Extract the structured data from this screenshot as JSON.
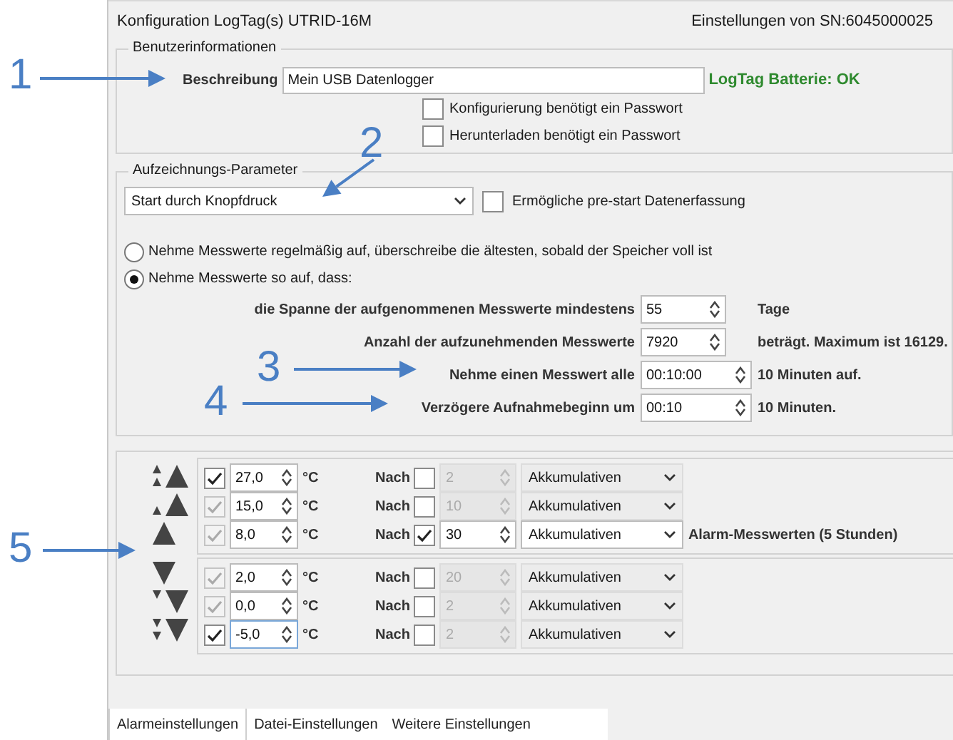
{
  "window": {
    "title": "Konfiguration LogTag(s) UTRID-16M",
    "serial": "Einstellungen von SN:6045000025"
  },
  "user_info": {
    "legend": "Benutzerinformationen",
    "description_label": "Beschreibung",
    "description_value": "Mein USB Datenlogger",
    "battery_status": "LogTag Batterie: OK",
    "options": [
      {
        "label": "Konfigurierung benötigt ein Passwort",
        "checked": false
      },
      {
        "label": "Herunterladen benötigt ein Passwort",
        "checked": false
      }
    ]
  },
  "recording": {
    "legend": "Aufzeichnungs-Parameter",
    "start_mode": "Start durch Knopfdruck",
    "prestart": {
      "label": "Ermögliche pre-start Datenerfassung",
      "checked": false
    },
    "modes": [
      {
        "label": "Nehme Messwerte regelmäßig auf, überschreibe die ältesten, sobald der Speicher voll ist",
        "selected": false
      },
      {
        "label": "Nehme Messwerte so auf, dass:",
        "selected": true
      }
    ],
    "params": [
      {
        "label": "die Spanne der aufgenommenen Messwerte mindestens",
        "value": "55",
        "unit": "Tage"
      },
      {
        "label": "Anzahl der aufzunehmenden Messwerte",
        "value": "7920",
        "unit": "beträgt. Maximum ist 16129."
      },
      {
        "label": "Nehme einen Messwert alle",
        "value": "00:10:00",
        "unit": "10 Minuten auf."
      },
      {
        "label": "Verzögere Aufnahmebeginn um",
        "value": "00:10",
        "unit": "10 Minuten."
      }
    ]
  },
  "alarms": {
    "groups": [
      {
        "rows": [
          {
            "checked": true,
            "disabled": false,
            "value": "27,0",
            "unit": "°C",
            "after_label": "Nach",
            "after_checked": false,
            "count": "2",
            "mode": "Akkumulativen"
          },
          {
            "checked": true,
            "disabled": true,
            "value": "15,0",
            "unit": "°C",
            "after_label": "Nach",
            "after_checked": false,
            "count": "10",
            "mode": "Akkumulativen"
          },
          {
            "checked": true,
            "disabled": true,
            "value": "8,0",
            "unit": "°C",
            "after_label": "Nach",
            "after_checked": true,
            "count": "30",
            "mode": "Akkumulativen",
            "note": "Alarm-Messwerten (5 Stunden)"
          }
        ]
      },
      {
        "rows": [
          {
            "checked": true,
            "disabled": true,
            "value": "2,0",
            "unit": "°C",
            "after_label": "Nach",
            "after_checked": false,
            "count": "20",
            "mode": "Akkumulativen"
          },
          {
            "checked": true,
            "disabled": true,
            "value": "0,0",
            "unit": "°C",
            "after_label": "Nach",
            "after_checked": false,
            "count": "2",
            "mode": "Akkumulativen"
          },
          {
            "checked": true,
            "disabled": false,
            "value": "-5,0",
            "unit": "°C",
            "after_label": "Nach",
            "after_checked": false,
            "count": "2",
            "mode": "Akkumulativen"
          }
        ]
      }
    ]
  },
  "tabs": [
    {
      "label": "Alarmeinstellungen",
      "selected": true
    },
    {
      "label": "Datei-Einstellungen",
      "selected": false
    },
    {
      "label": "Weitere Einstellungen",
      "selected": false
    }
  ],
  "callouts": [
    {
      "number": "1"
    },
    {
      "number": "2"
    },
    {
      "number": "3"
    },
    {
      "number": "4"
    },
    {
      "number": "5"
    }
  ]
}
